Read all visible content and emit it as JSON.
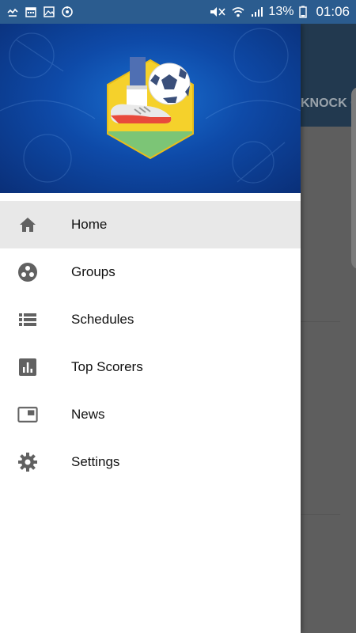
{
  "status_bar": {
    "battery_percent": "13%",
    "time": "01:06"
  },
  "background": {
    "tab_label": "KNOCK OUT"
  },
  "drawer": {
    "menu": [
      {
        "label": "Home",
        "icon": "home-icon",
        "active": true
      },
      {
        "label": "Groups",
        "icon": "groups-icon",
        "active": false
      },
      {
        "label": "Schedules",
        "icon": "list-icon",
        "active": false
      },
      {
        "label": "Top Scorers",
        "icon": "bar-chart-icon",
        "active": false
      },
      {
        "label": "News",
        "icon": "news-icon",
        "active": false
      },
      {
        "label": "Settings",
        "icon": "gear-icon",
        "active": false
      }
    ]
  },
  "colors": {
    "status_bar": "#2b5c8f",
    "header_blue": "#0e4aa8",
    "active_item": "#e8e8e8",
    "icon_gray": "#616161"
  }
}
